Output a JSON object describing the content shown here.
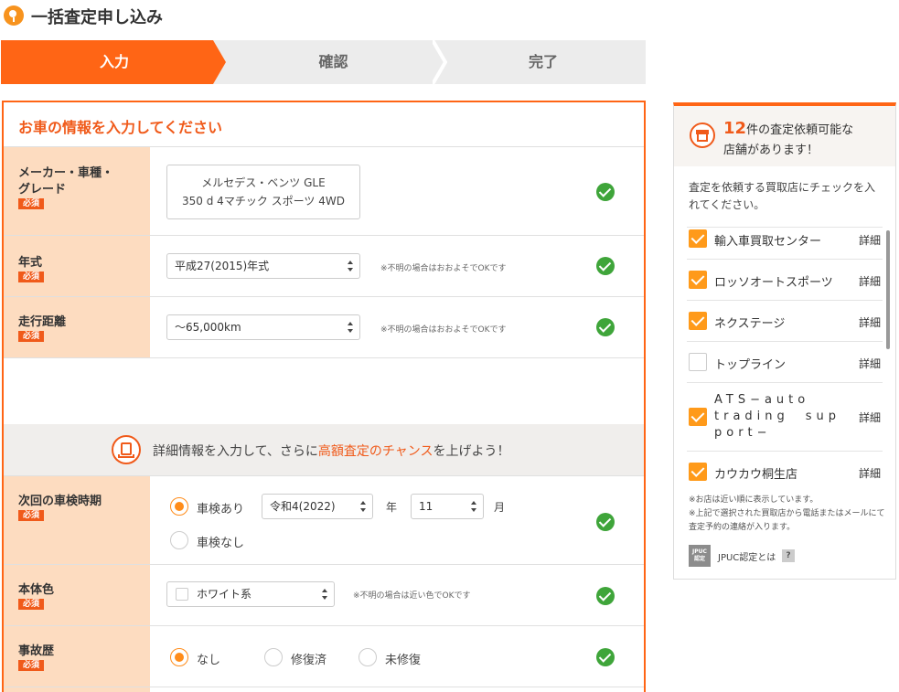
{
  "header": {
    "title": "一括査定申し込み"
  },
  "steps": [
    "入力",
    "確認",
    "完了"
  ],
  "form": {
    "heading": "お車の情報を入力してください",
    "required_badge": "必須",
    "maker": {
      "label_line1": "メーカー・車種・",
      "label_line2": "グレード",
      "value_line1": "メルセデス・ベンツ GLE",
      "value_line2": "350 d 4マチック スポーツ 4WD"
    },
    "year": {
      "label": "年式",
      "value": "平成27(2015)年式",
      "note": "※不明の場合はおおよそでOKです"
    },
    "mileage": {
      "label": "走行距離",
      "value": "〜65,000km",
      "note": "※不明の場合はおおよそでOKです"
    },
    "detail_banner": {
      "pre": "詳細情報を入力して、さらに",
      "highlight": "高額査定のチャンス",
      "post": "を上げよう！"
    },
    "inspection": {
      "label": "次回の車検時期",
      "option_yes": "車検あり",
      "option_no": "車検なし",
      "era_value": "令和4(2022)",
      "year_unit": "年",
      "month_value": "11",
      "month_unit": "月"
    },
    "color": {
      "label": "本体色",
      "value": "ホワイト系",
      "note": "※不明の場合は近い色でOKです"
    },
    "accident": {
      "label": "事故歴",
      "options": [
        "なし",
        "修復済",
        "未修復"
      ]
    }
  },
  "sidebar": {
    "count_num": "12",
    "count_text1": "件の査定依頼可能な",
    "count_text2": "店舗があります！",
    "instruction": "査定を依頼する買取店にチェックを入れてください。",
    "detail_label": "詳細",
    "shops": [
      {
        "name": "輸入車買取センター",
        "checked": true
      },
      {
        "name": "ロッソオートスポーツ",
        "checked": true
      },
      {
        "name": "ネクステージ",
        "checked": true
      },
      {
        "name": "トップライン",
        "checked": false
      },
      {
        "name": "ATS−auto　trading　sup　port−",
        "checked": true
      },
      {
        "name": "カウカウ桐生店",
        "checked": true
      }
    ],
    "footnote1": "※お店は近い順に表示しています。",
    "footnote2": "※上記で選択された買取店から電話またはメールにて査定予約の連絡が入ります。",
    "jpuc_logo_line1": "JPUC",
    "jpuc_logo_line2": "認定",
    "jpuc_text": "JPUC認定とは",
    "help_mark": "?"
  },
  "colors": {
    "accent": "#ff6515",
    "label_bg": "#fddcc0",
    "ok_green": "#3fa53a",
    "check_orange": "#ff9a1a"
  },
  "icons": [
    "logo-icon",
    "document-icon",
    "shop-icon",
    "check-ok-icon",
    "select-arrows-icon",
    "help-icon"
  ]
}
